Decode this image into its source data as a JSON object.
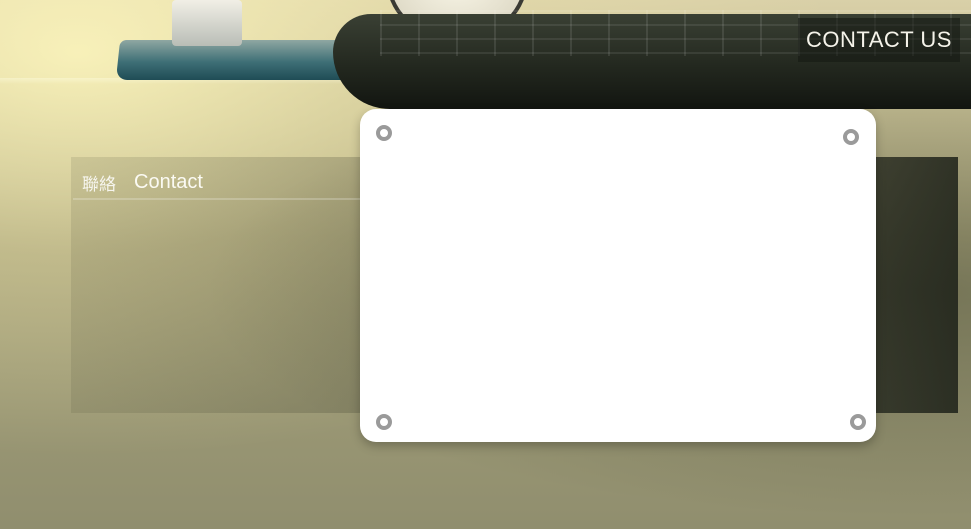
{
  "header": {
    "contact_us_label": "CONTACT US"
  },
  "section": {
    "title_cn": "聯絡",
    "title_en": "Contact"
  },
  "card": {
    "pins": [
      "pin-icon",
      "pin-icon",
      "pin-icon",
      "pin-icon"
    ]
  },
  "background": {
    "scene": [
      "monitor-stand",
      "desk-clock",
      "keyboard"
    ]
  },
  "colors": {
    "card_bg": "#ffffff",
    "header_text": "#f5f3ea",
    "pin_ring": "#9a9a9a"
  }
}
